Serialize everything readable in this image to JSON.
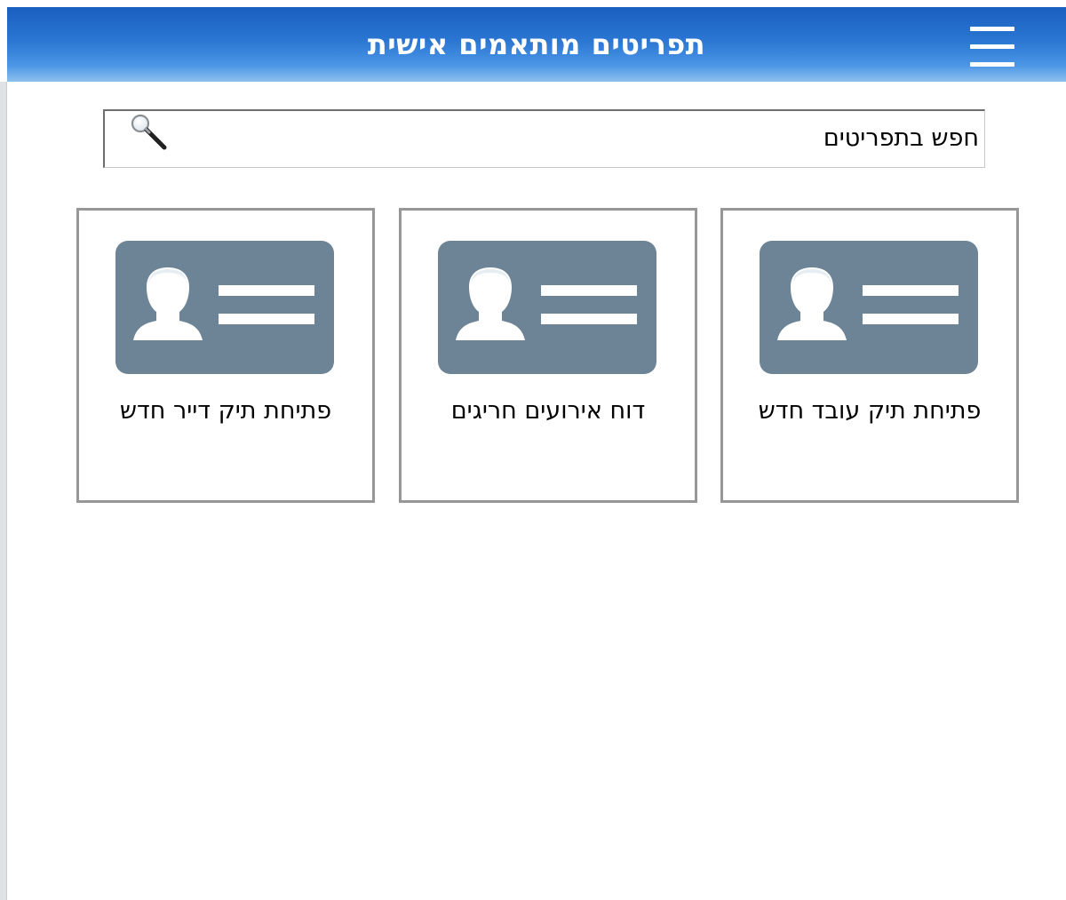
{
  "header": {
    "title": "תפריטים מותאמים אישית",
    "menu_icon": "hamburger-menu-icon"
  },
  "search": {
    "placeholder": "חפש בתפריטים",
    "value": "",
    "icon": "search-icon"
  },
  "tiles": [
    {
      "label": "פתיחת תיק עובד חדש",
      "icon": "id-card-icon"
    },
    {
      "label": "דוח אירועים חריגים",
      "icon": "id-card-icon"
    },
    {
      "label": "פתיחת תיק דייר חדש",
      "icon": "id-card-icon"
    }
  ],
  "colors": {
    "header_gradient_top": "#1a5fc0",
    "header_gradient_bottom": "#8fc0ee",
    "card_icon_fill": "#6d8496",
    "tile_border": "#979797"
  }
}
